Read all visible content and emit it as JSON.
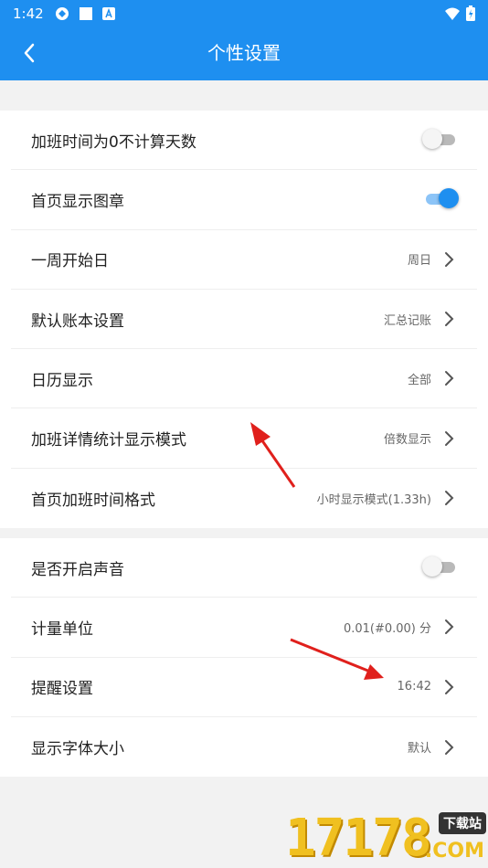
{
  "status_bar": {
    "time": "1:42"
  },
  "header": {
    "title": "个性设置"
  },
  "group1": {
    "items": [
      {
        "label": "加班时间为0不计算天数",
        "type": "switch",
        "on": false
      },
      {
        "label": "首页显示图章",
        "type": "switch",
        "on": true
      },
      {
        "label": "一周开始日",
        "type": "value",
        "value": "周日"
      },
      {
        "label": "默认账本设置",
        "type": "value",
        "value": "汇总记账"
      },
      {
        "label": "日历显示",
        "type": "value",
        "value": "全部"
      },
      {
        "label": "加班详情统计显示模式",
        "type": "value",
        "value": "倍数显示"
      },
      {
        "label": "首页加班时间格式",
        "type": "value",
        "value": "小时显示模式(1.33h)"
      }
    ]
  },
  "group2": {
    "items": [
      {
        "label": "是否开启声音",
        "type": "switch",
        "on": false
      },
      {
        "label": "计量单位",
        "type": "value",
        "value": "0.01(#0.00) 分"
      },
      {
        "label": "提醒设置",
        "type": "value",
        "value": "16:42"
      },
      {
        "label": "显示字体大小",
        "type": "value",
        "value": "默认"
      }
    ]
  },
  "watermark": {
    "numbers": "17178",
    "badge": "下载站",
    "suffix": ".COM"
  },
  "colors": {
    "primary": "#1e8ff0",
    "annotation_arrow": "#e0201c"
  }
}
